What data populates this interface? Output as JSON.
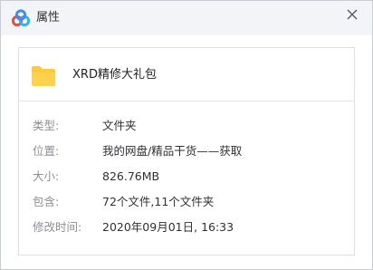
{
  "window": {
    "title": "属性"
  },
  "file": {
    "name": "XRD精修大礼包"
  },
  "properties": [
    {
      "label": "类型:",
      "value": "文件夹"
    },
    {
      "label": "位置:",
      "value": "我的网盘/精品干货——获取"
    },
    {
      "label": "大小:",
      "value": "826.76MB"
    },
    {
      "label": "包含:",
      "value": "72个文件,11个文件夹"
    },
    {
      "label": "修改时间:",
      "value": "2020年09月01日, 16:33"
    }
  ],
  "icons": {
    "app": "baidu-netdisk-cloud-icon",
    "close": "close-icon",
    "file": "folder-icon"
  },
  "colors": {
    "titlebar_bg": "#f3f4f7",
    "folder_yellow": "#ffc93c",
    "logo_red": "#e34f40",
    "logo_blue": "#3e8af7",
    "logo_cyan": "#2fb6e8"
  }
}
